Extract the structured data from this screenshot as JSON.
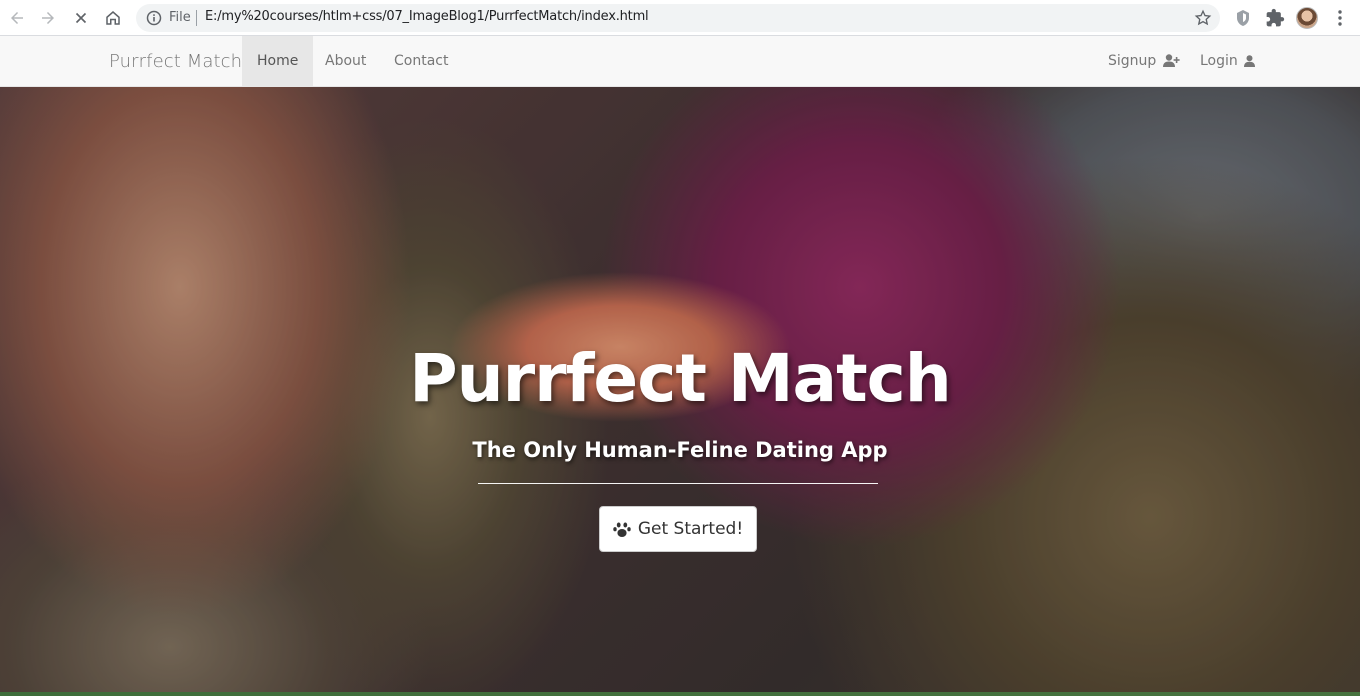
{
  "browser": {
    "omnibox": {
      "scheme_label": "File",
      "url": "E:/my%20courses/htlm+css/07_ImageBlog1/PurrfectMatch/index.html"
    },
    "icons": [
      "back-icon",
      "forward-icon",
      "stop-icon",
      "home-icon",
      "info-icon",
      "star-icon",
      "extension-shield-icon",
      "puzzle-icon",
      "avatar",
      "more-icon"
    ]
  },
  "navbar": {
    "brand": "Purrfect Match",
    "items": [
      {
        "label": "Home",
        "active": true
      },
      {
        "label": "About",
        "active": false
      },
      {
        "label": "Contact",
        "active": false
      }
    ],
    "right": [
      {
        "label": "Signup",
        "icon": "user-plus-icon"
      },
      {
        "label": "Login",
        "icon": "user-icon"
      }
    ]
  },
  "hero": {
    "title": "Purrfect Match",
    "subtitle": "The Only Human-Feline Dating App",
    "cta_label": "Get Started!",
    "cta_icon": "paw-icon"
  }
}
